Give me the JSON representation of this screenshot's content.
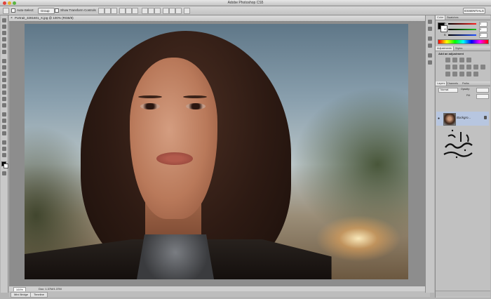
{
  "window": {
    "title": "Adobe Photoshop CS5",
    "traffic_colors": [
      "#e0443c",
      "#e6b12b",
      "#5bb441"
    ]
  },
  "options_bar": {
    "auto_select_label": "Auto-Select:",
    "auto_select_value": "Group",
    "show_transform_label": "Show Transform Controls",
    "workspace_label": "ESSENTIALS"
  },
  "document": {
    "tab_label": "Portrait_3281601_X.jpg @ 100% (RGB/8)"
  },
  "status": {
    "zoom": "100%",
    "doc_size": "Doc: 1.37M/1.37M"
  },
  "mini_tabs": [
    "Mini Bridge",
    "Timeline"
  ],
  "color_panel": {
    "tabs": [
      "Color",
      "Swatches"
    ],
    "channels": [
      {
        "label": "R",
        "value": "0",
        "gradient": "#ff2020"
      },
      {
        "label": "G",
        "value": "0",
        "gradient": "#20c020"
      },
      {
        "label": "B",
        "value": "0",
        "gradient": "#2050ff"
      }
    ],
    "fg_color": "#000000",
    "bg_color": "#ffffff"
  },
  "adjustments_panel": {
    "tabs": [
      "Adjustments",
      "Styles"
    ],
    "heading": "Add an adjustment"
  },
  "layers_panel": {
    "tabs": [
      "Layers",
      "Channels",
      "Paths"
    ],
    "blend_mode": "Normal",
    "opacity_label": "Opacity:",
    "fill_label": "Fill:",
    "layer_name": "Backgro..."
  },
  "watermark": {
    "text": "وب تدریس"
  }
}
